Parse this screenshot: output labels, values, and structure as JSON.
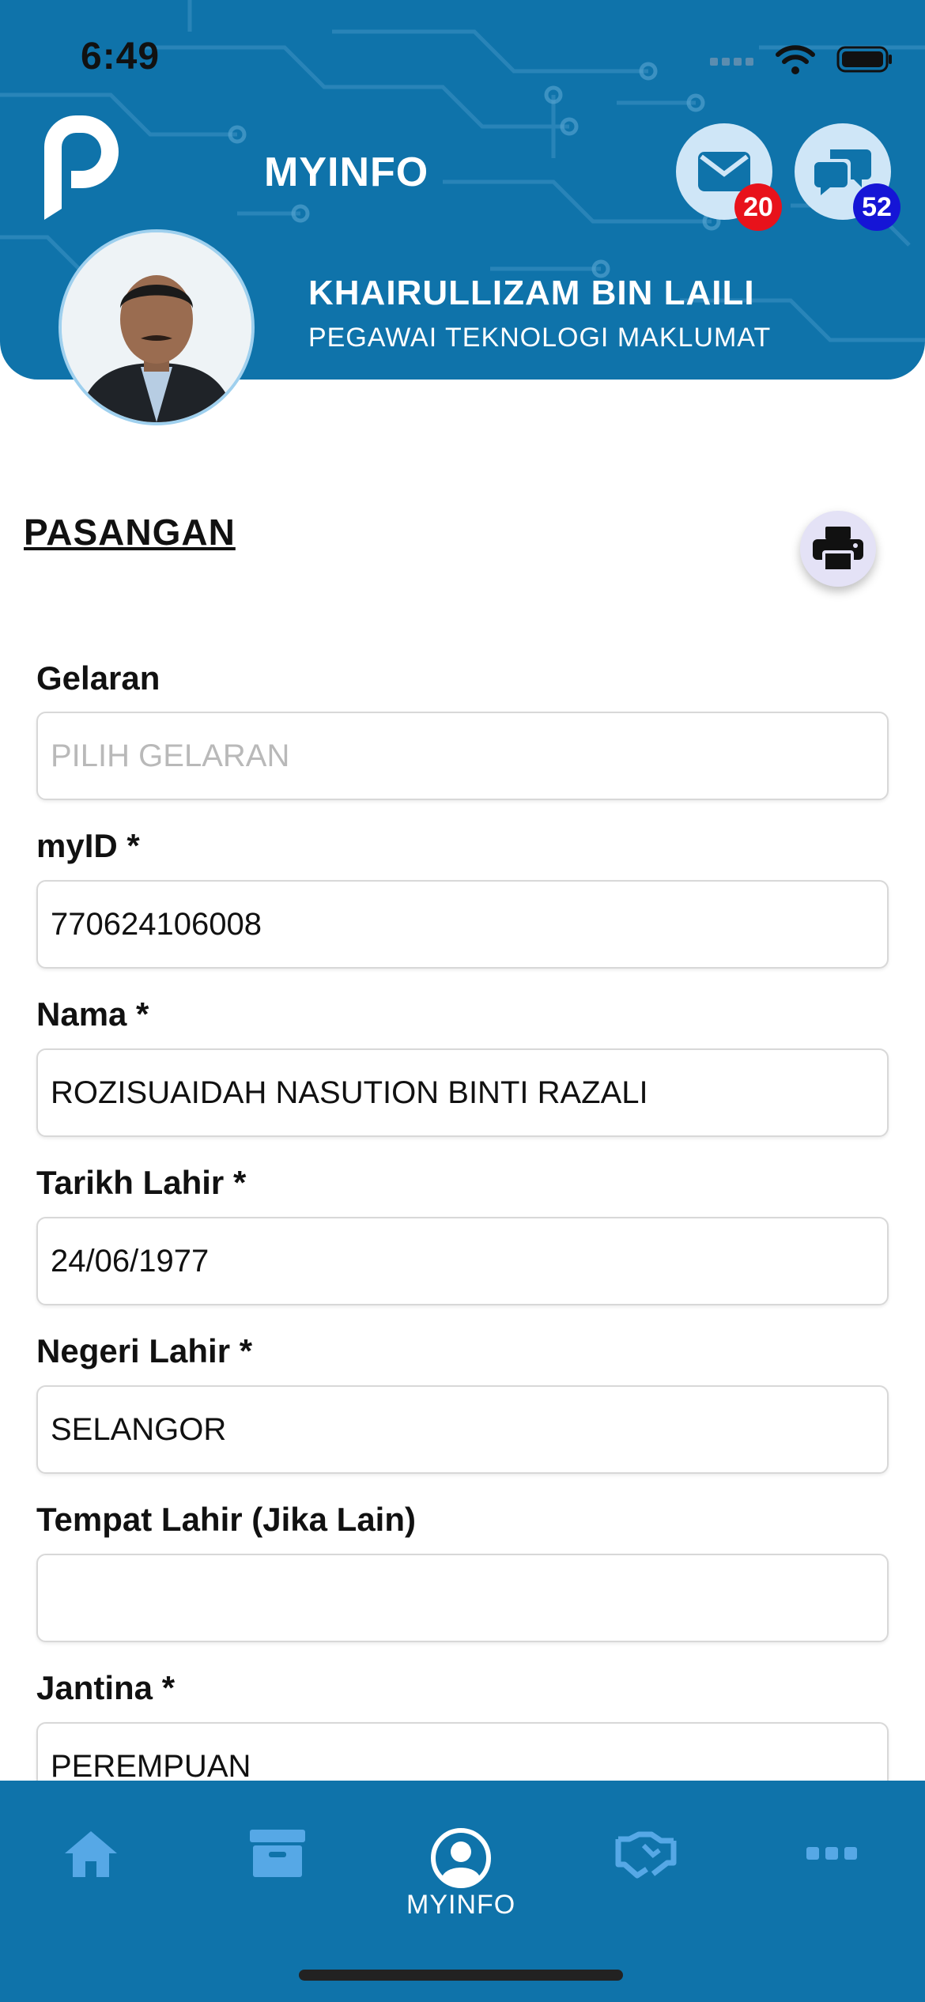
{
  "status_bar": {
    "time": "6:49"
  },
  "header": {
    "app_title": "MYINFO",
    "mail_badge": "20",
    "chat_badge": "52",
    "user_name": "KHAIRULLIZAM BIN LAILI",
    "user_role": "PEGAWAI TEKNOLOGI MAKLUMAT"
  },
  "section": {
    "title": "PASANGAN"
  },
  "form": {
    "fields": [
      {
        "label": "Gelaran",
        "value": "",
        "placeholder": "PILIH GELARAN"
      },
      {
        "label": "myID *",
        "value": "770624106008"
      },
      {
        "label": "Nama *",
        "value": "ROZISUAIDAH NASUTION BINTI RAZALI"
      },
      {
        "label": "Tarikh Lahir *",
        "value": "24/06/1977"
      },
      {
        "label": "Negeri Lahir *",
        "value": "SELANGOR"
      },
      {
        "label": "Tempat Lahir (Jika Lain)",
        "value": ""
      },
      {
        "label": "Jantina *",
        "value": "PEREMPUAN"
      }
    ]
  },
  "tabbar": {
    "items": [
      {
        "icon": "home-icon",
        "label": ""
      },
      {
        "icon": "archive-icon",
        "label": ""
      },
      {
        "icon": "user-circle-icon",
        "label": "MYINFO",
        "active": true
      },
      {
        "icon": "handshake-icon",
        "label": ""
      },
      {
        "icon": "more-icon",
        "label": ""
      }
    ]
  },
  "colors": {
    "primary": "#0f73aa",
    "icon_light": "#cfe6f7",
    "badge_red": "#e8121b",
    "badge_blue": "#1515d6"
  }
}
